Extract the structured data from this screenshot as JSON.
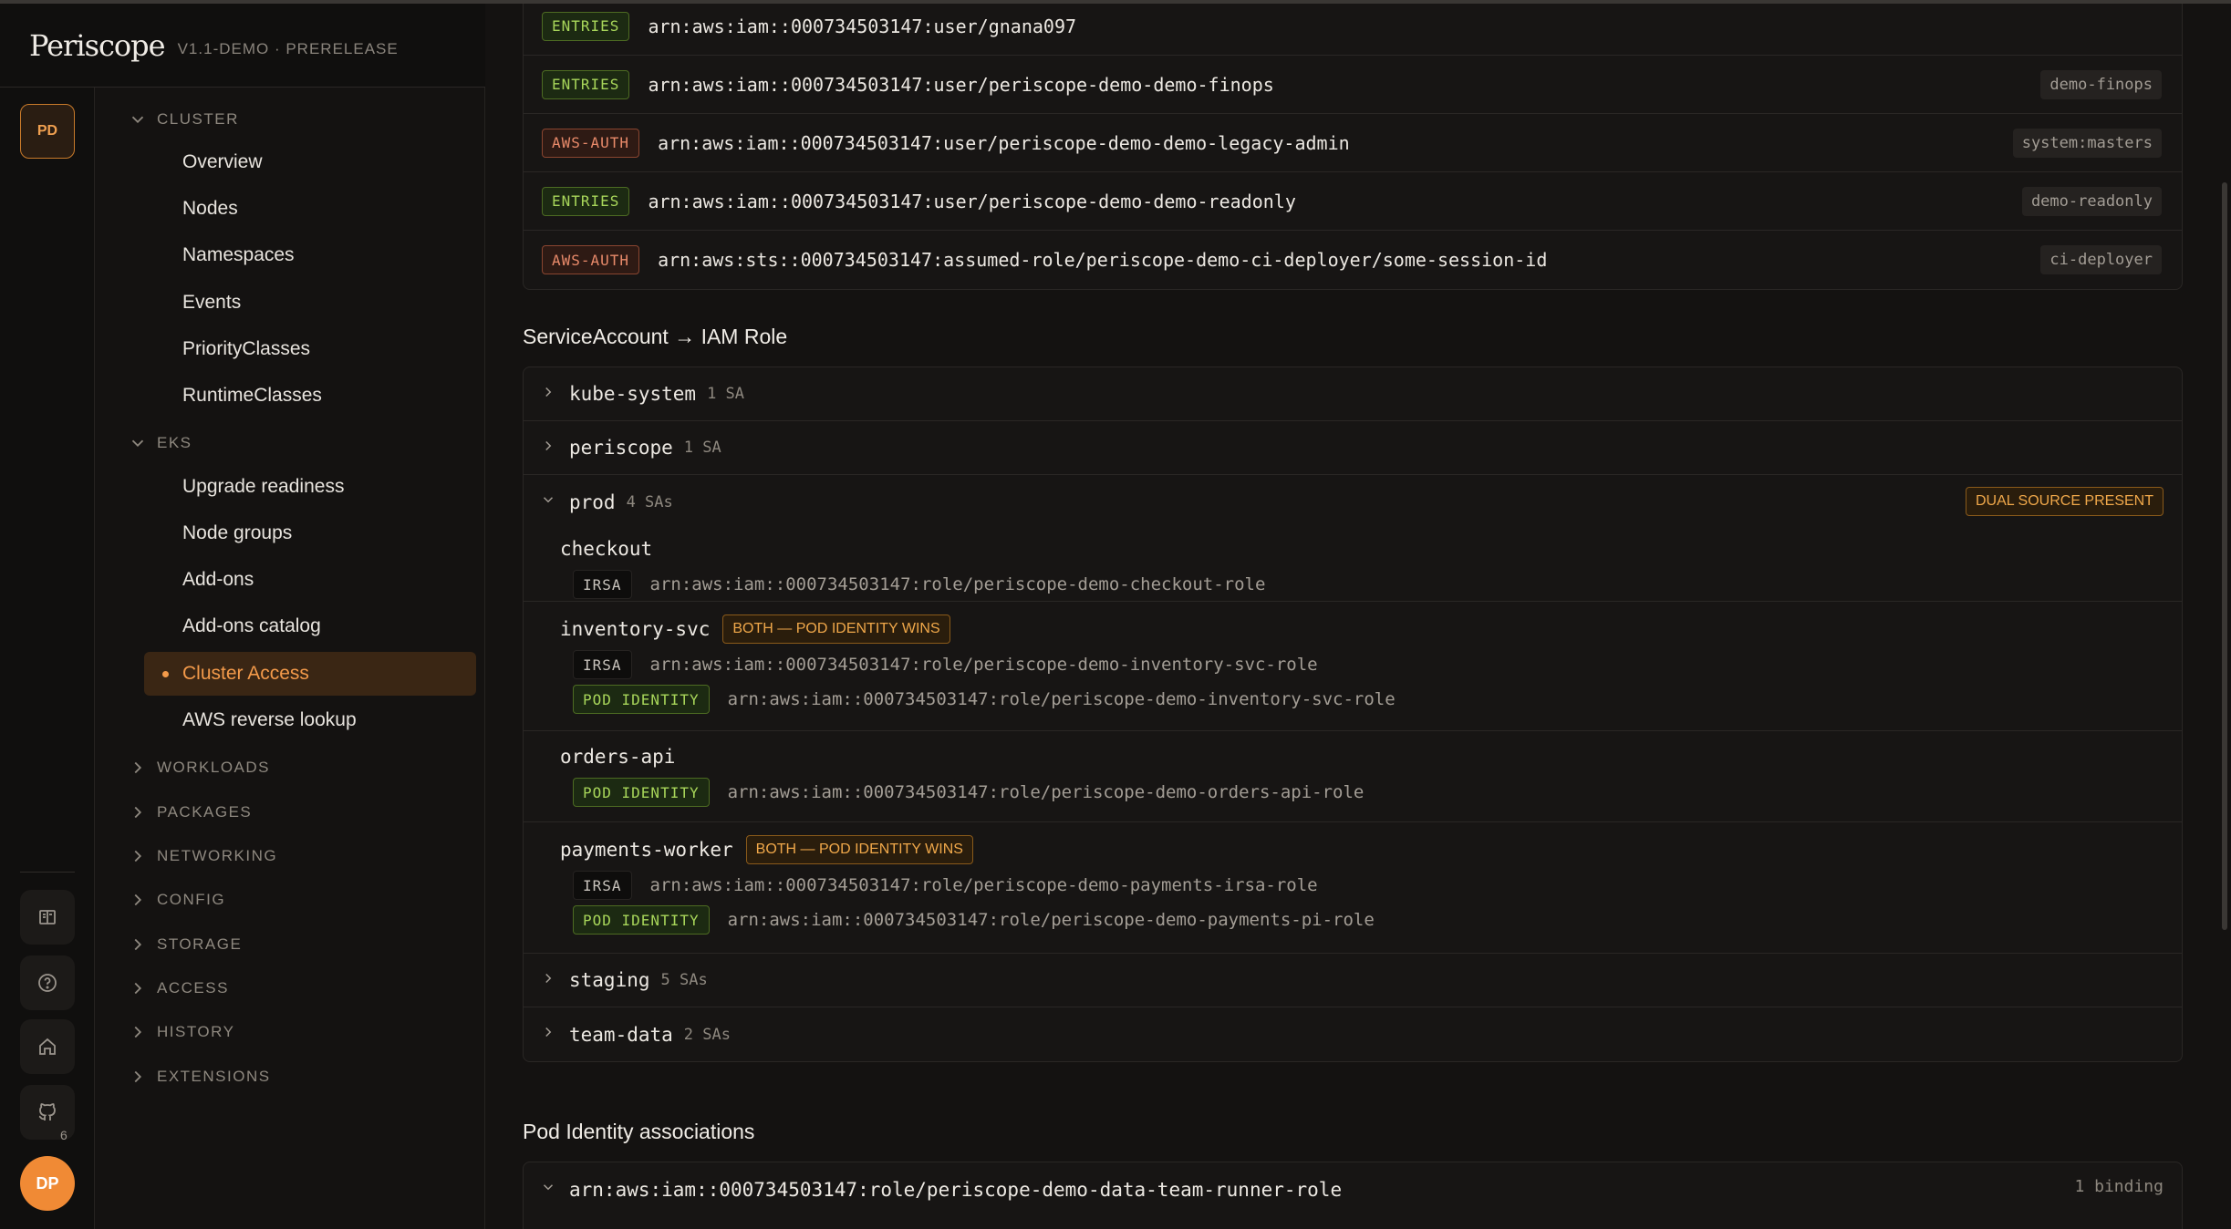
{
  "brand": {
    "name": "Periscope",
    "version": "V1.1-DEMO · PRERELEASE"
  },
  "rail": {
    "cluster_badge": "PD",
    "github_count": "6",
    "avatar": "DP"
  },
  "sidebar": {
    "cluster_section": "CLUSTER",
    "cluster_items": [
      "Overview",
      "Nodes",
      "Namespaces",
      "Events",
      "PriorityClasses",
      "RuntimeClasses"
    ],
    "eks_section": "EKS",
    "eks_items": [
      "Upgrade readiness",
      "Node groups",
      "Add-ons",
      "Add-ons catalog",
      "Cluster Access",
      "AWS reverse lookup"
    ],
    "collapsed_sections": [
      "WORKLOADS",
      "PACKAGES",
      "NETWORKING",
      "CONFIG",
      "STORAGE",
      "ACCESS",
      "HISTORY",
      "EXTENSIONS"
    ]
  },
  "access_entries": [
    {
      "source": "ENTRIES",
      "arn": "arn:aws:iam::000734503147:user/gnana097",
      "group": ""
    },
    {
      "source": "ENTRIES",
      "arn": "arn:aws:iam::000734503147:user/periscope-demo-demo-finops",
      "group": "demo-finops"
    },
    {
      "source": "AWS-AUTH",
      "arn": "arn:aws:iam::000734503147:user/periscope-demo-demo-legacy-admin",
      "group": "system:masters"
    },
    {
      "source": "ENTRIES",
      "arn": "arn:aws:iam::000734503147:user/periscope-demo-demo-readonly",
      "group": "demo-readonly"
    },
    {
      "source": "AWS-AUTH",
      "arn": "arn:aws:sts::000734503147:assumed-role/periscope-demo-ci-deployer/some-session-id",
      "group": "ci-deployer"
    }
  ],
  "sa_section": {
    "title": "ServiceAccount → IAM Role",
    "namespaces": [
      {
        "name": "kube-system",
        "count": "1 SA"
      },
      {
        "name": "periscope",
        "count": "1 SA"
      },
      {
        "name": "prod",
        "count": "4 SAs",
        "badge": "DUAL SOURCE PRESENT"
      },
      {
        "name": "staging",
        "count": "5 SAs"
      },
      {
        "name": "team-data",
        "count": "2 SAs"
      }
    ],
    "prod_accounts": {
      "checkout": {
        "name": "checkout",
        "irsa": "arn:aws:iam::000734503147:role/periscope-demo-checkout-role"
      },
      "inventory": {
        "name": "inventory-svc",
        "badge": "BOTH — POD IDENTITY WINS",
        "irsa": "arn:aws:iam::000734503147:role/periscope-demo-inventory-svc-role",
        "pod_identity": "arn:aws:iam::000734503147:role/periscope-demo-inventory-svc-role"
      },
      "orders": {
        "name": "orders-api",
        "pod_identity": "arn:aws:iam::000734503147:role/periscope-demo-orders-api-role"
      },
      "payments": {
        "name": "payments-worker",
        "badge": "BOTH — POD IDENTITY WINS",
        "irsa": "arn:aws:iam::000734503147:role/periscope-demo-payments-irsa-role",
        "pod_identity": "arn:aws:iam::000734503147:role/periscope-demo-payments-pi-role"
      }
    },
    "labels": {
      "irsa": "IRSA",
      "pod_identity": "POD IDENTITY"
    }
  },
  "pod_identity_section": {
    "title": "Pod Identity associations",
    "first_role": "arn:aws:iam::000734503147:role/periscope-demo-data-team-runner-role",
    "first_binding": "1 binding"
  }
}
